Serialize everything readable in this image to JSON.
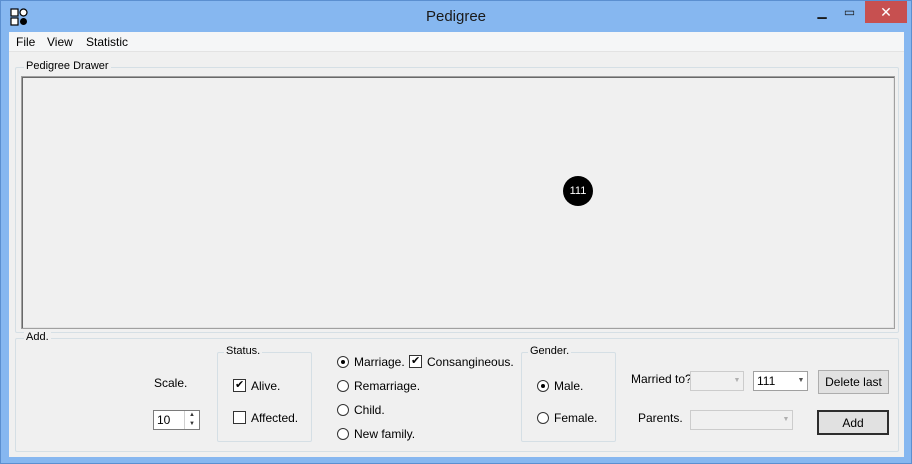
{
  "window": {
    "title": "Pedigree",
    "minimize_glyph": "▁",
    "maximize_glyph": "▭",
    "close_glyph": "✕"
  },
  "menu": [
    "File",
    "View",
    "Statistic"
  ],
  "drawer": {
    "label": "Pedigree Drawer",
    "nodes": [
      {
        "label": "111",
        "color": "#000000"
      }
    ]
  },
  "add_panel": {
    "label": "Add.",
    "scale": {
      "label": "Scale.",
      "value": "10"
    },
    "status": {
      "label": "Status.",
      "alive": {
        "label": "Alive.",
        "checked": true
      },
      "affected": {
        "label": "Affected.",
        "checked": false
      }
    },
    "relation": {
      "options": [
        {
          "label": "Marriage.",
          "selected": true
        },
        {
          "label": "Remarriage.",
          "selected": false
        },
        {
          "label": "Child.",
          "selected": false
        },
        {
          "label": "New family.",
          "selected": false
        }
      ],
      "consanguineous": {
        "label": "Consangineous.",
        "checked": true
      }
    },
    "gender": {
      "label": "Gender.",
      "male": {
        "label": "Male.",
        "selected": true
      },
      "female": {
        "label": "Female.",
        "selected": false
      }
    },
    "married_to": {
      "label": "Married to?",
      "first_value": "",
      "second_value": "111"
    },
    "parents": {
      "label": "Parents.",
      "value": ""
    },
    "delete_last_label": "Delete last",
    "add_label": "Add"
  }
}
